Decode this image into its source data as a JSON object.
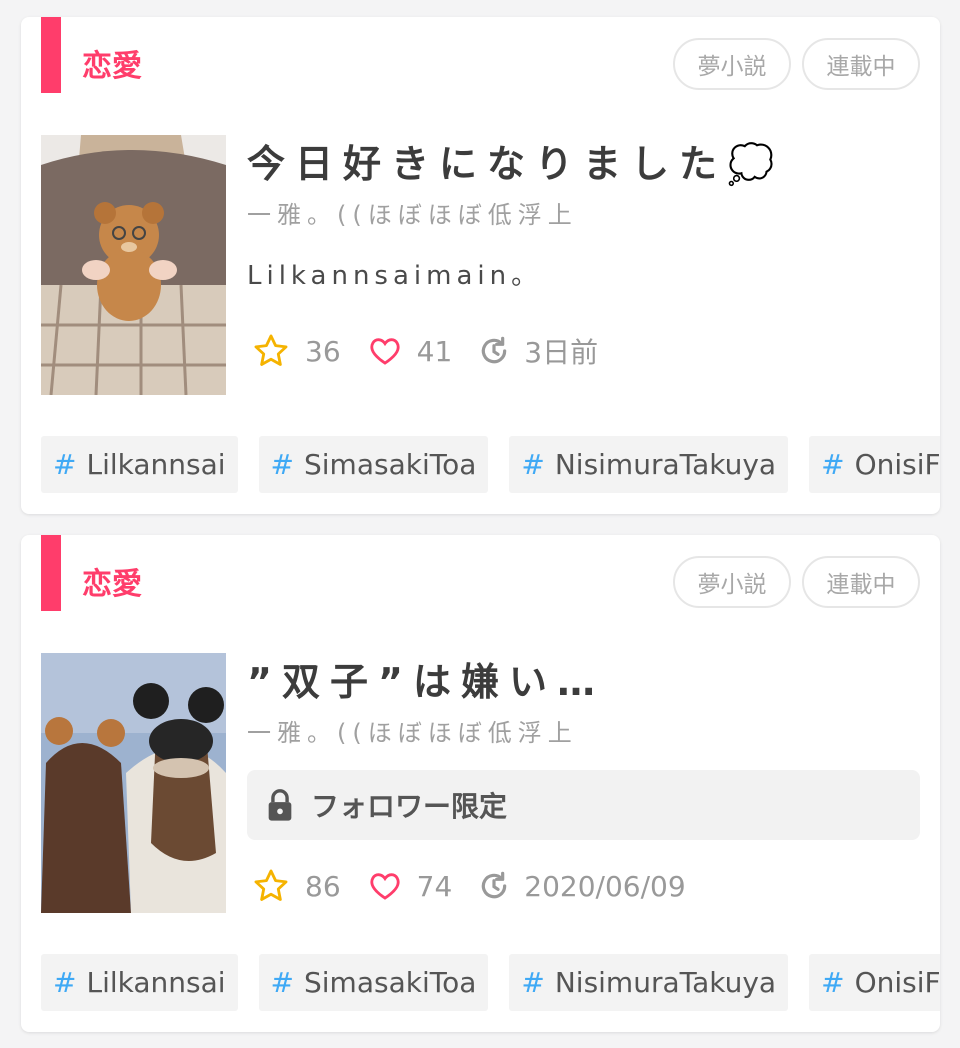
{
  "accent_color": "#ff3d6b",
  "tag_hash_color": "#3fa9f5",
  "cards": [
    {
      "genre": "恋愛",
      "badges": [
        "夢小説",
        "連載中"
      ],
      "thumbnail": "girl-holding-teddy-bear",
      "title": "今日好きになりました💭",
      "author": "一雅。((ほぼほぼ低浮上",
      "description": "Lilkannsaimain。",
      "stats": {
        "stars": "36",
        "likes": "41",
        "updated": "3日前"
      },
      "tags": [
        {
          "hash": "#",
          "label": "Lilkannsai"
        },
        {
          "hash": "#",
          "label": "SimasakiToa"
        },
        {
          "hash": "#",
          "label": "NisimuraTakuya"
        },
        {
          "hash": "#",
          "label": "OnisiFuga"
        }
      ]
    },
    {
      "genre": "恋愛",
      "badges": [
        "夢小説",
        "連載中"
      ],
      "thumbnail": "two-girls-with-mouse-ears",
      "title": "”双子”は嫌い…",
      "author": "一雅。((ほぼほぼ低浮上",
      "locked_label": "フォロワー限定",
      "stats": {
        "stars": "86",
        "likes": "74",
        "updated": "2020/06/09"
      },
      "tags": [
        {
          "hash": "#",
          "label": "Lilkannsai"
        },
        {
          "hash": "#",
          "label": "SimasakiToa"
        },
        {
          "hash": "#",
          "label": "NisimuraTakuya"
        },
        {
          "hash": "#",
          "label": "OnisiFuga"
        }
      ]
    }
  ]
}
